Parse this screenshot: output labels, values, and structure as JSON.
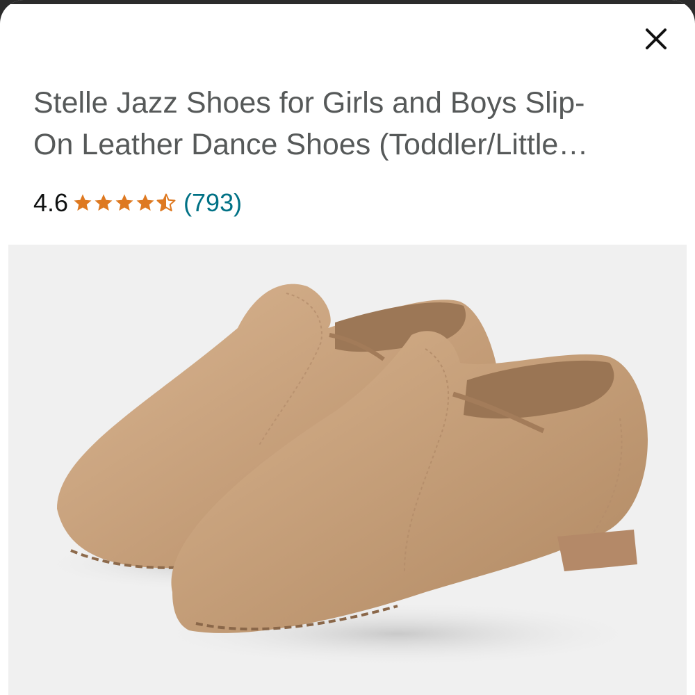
{
  "product": {
    "title_line1": "Stelle Jazz Shoes for Girls and Boys Slip-",
    "title_line2": "On Leather Dance Shoes (Toddler/Little…",
    "rating_value": "4.6",
    "rating_stars": 4.6,
    "review_count": "(793)"
  },
  "colors": {
    "title_text": "#565959",
    "star": "#de7921",
    "review_link": "#007185",
    "image_background": "#f0f0f0",
    "shoe_leather": "#caa37e"
  },
  "icons": {
    "close": "close-icon",
    "star": "star-icon",
    "product_image": "tan-jazz-shoes"
  }
}
